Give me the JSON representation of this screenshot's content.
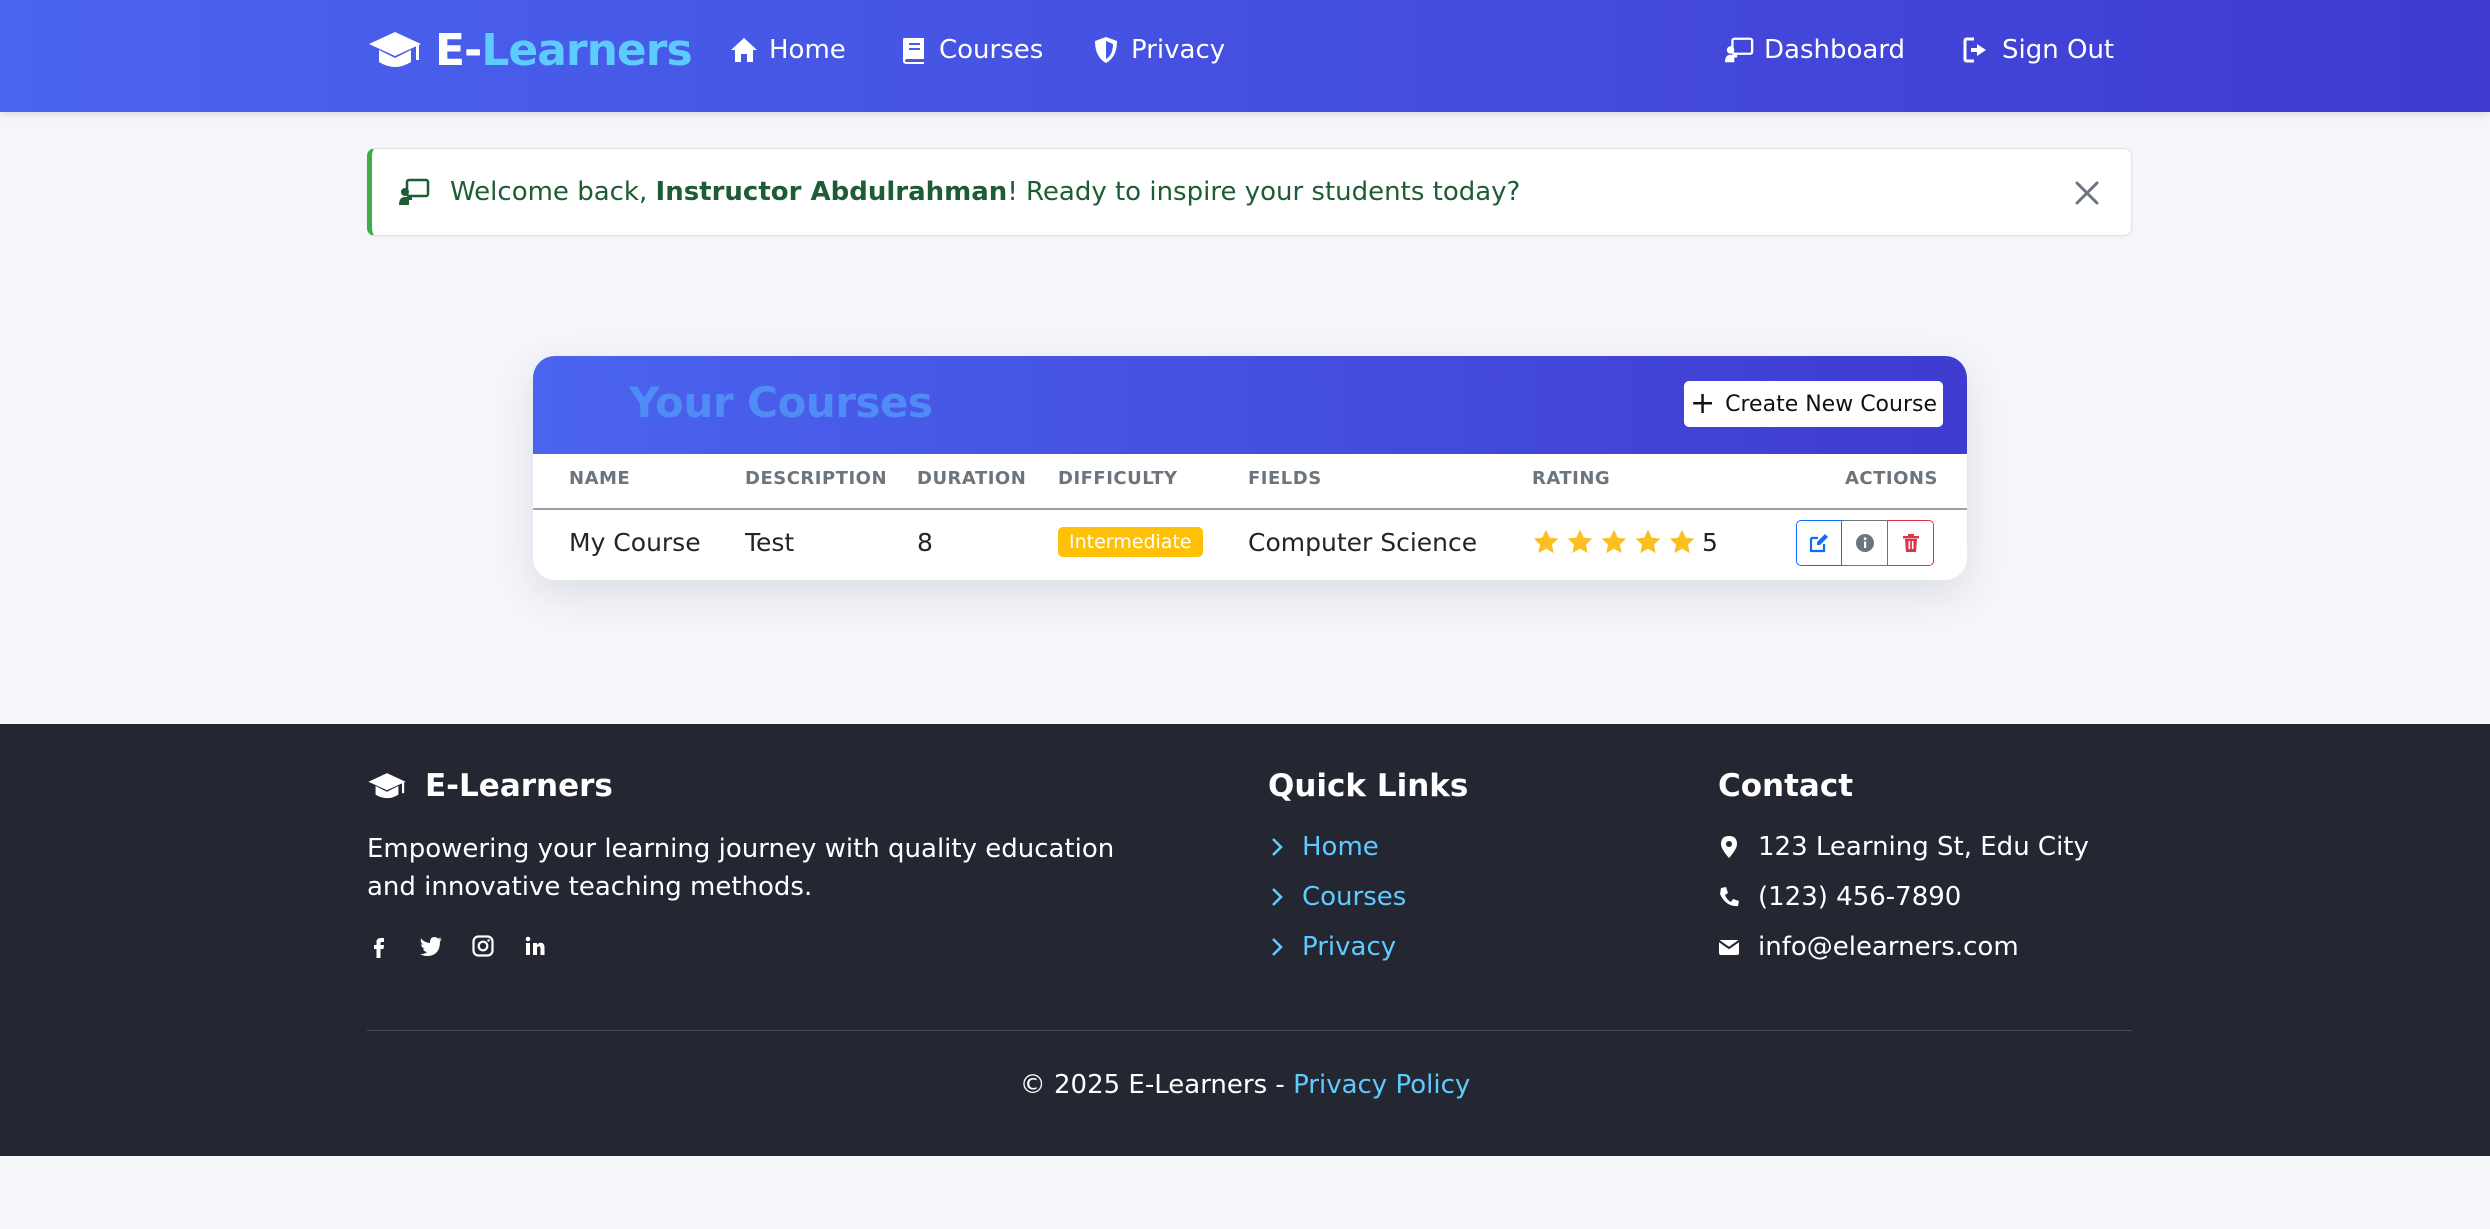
{
  "nav": {
    "brand_part1": "E-",
    "brand_part2": "Learners",
    "home": "Home",
    "courses": "Courses",
    "privacy": "Privacy",
    "dashboard": "Dashboard",
    "signout": "Sign Out"
  },
  "alert": {
    "prefix": "Welcome back, ",
    "name": "Instructor Abdulrahman",
    "suffix": "! Ready to inspire your students today?"
  },
  "courses": {
    "title": "Your Courses",
    "create_label": "Create New Course",
    "columns": [
      "NAME",
      "DESCRIPTION",
      "DURATION",
      "DIFFICULTY",
      "FIELDS",
      "RATING",
      "ACTIONS"
    ],
    "rows": [
      {
        "name": "My Course",
        "description": "Test",
        "duration": "8",
        "difficulty": "Intermediate",
        "fields": "Computer Science",
        "stars": 5,
        "rating": "5"
      }
    ]
  },
  "footer": {
    "brand": "E-Learners",
    "description": "Empowering your learning journey with quality education and innovative teaching methods.",
    "social_icons": [
      "facebook-icon",
      "twitter-icon",
      "instagram-icon",
      "linkedin-icon"
    ],
    "quick_links_title": "Quick Links",
    "quick_links": [
      "Home",
      "Courses",
      "Privacy"
    ],
    "contact_title": "Contact",
    "address": "123 Learning St, Edu City",
    "phone": "(123) 456-7890",
    "email": "info@elearners.com",
    "copyright": "© 2025 E-Learners - ",
    "privacy_policy": "Privacy Policy"
  },
  "colors": {
    "nav_gradient_start": "#4a64ef",
    "nav_gradient_end": "#3f3bd1",
    "brand_accent": "#5ecbff",
    "difficulty_badge": "#ffc107",
    "star": "#fbbf24",
    "footer_bg": "#242732"
  }
}
